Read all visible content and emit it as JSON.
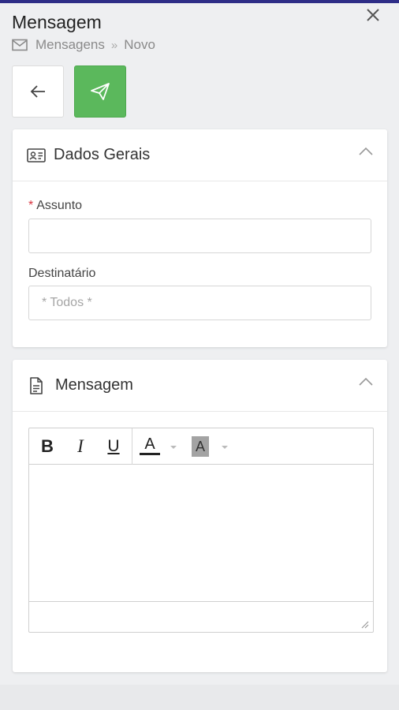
{
  "header": {
    "title": "Mensagem",
    "breadcrumb": {
      "root": "Mensagens",
      "current": "Novo"
    }
  },
  "toolbar": {
    "back_icon": "arrow-left-icon",
    "send_icon": "paper-plane-icon",
    "send_color": "#5bb85c"
  },
  "dados_gerais": {
    "title": "Dados Gerais",
    "icon": "id-card-icon",
    "assunto_label": "Assunto",
    "assunto_required": "*",
    "assunto_value": "",
    "destinatario_label": "Destinatário",
    "destinatario_placeholder": "* Todos *"
  },
  "mensagem": {
    "title": "Mensagem",
    "icon": "document-icon",
    "editor": {
      "bold": "B",
      "italic": "I",
      "underline": "U",
      "font_color": "A",
      "background_color": "A"
    }
  },
  "colors": {
    "accent": "#2e2d87",
    "success": "#5bb85c",
    "required": "#d9333f"
  }
}
